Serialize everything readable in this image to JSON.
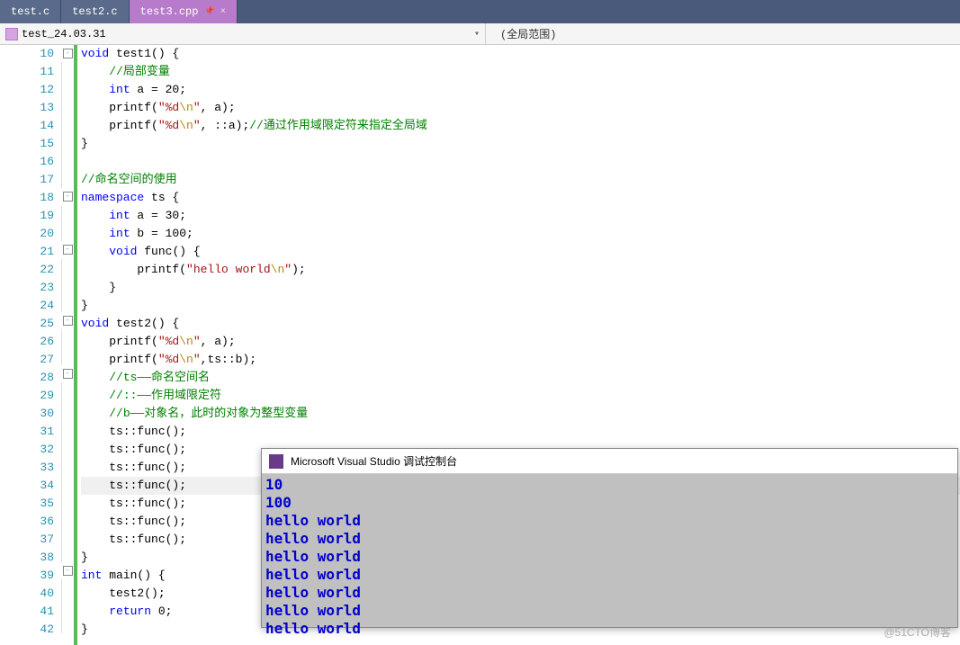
{
  "tabs": [
    {
      "label": "test.c"
    },
    {
      "label": "test2.c"
    },
    {
      "label": "test3.cpp",
      "active": true
    }
  ],
  "breadcrumb": {
    "project": "test_24.03.31",
    "scope": "(全局范围)"
  },
  "lineStart": 10,
  "lineEnd": 42,
  "code": {
    "10": [
      [
        "kw",
        "void"
      ],
      [
        "nm",
        " test1() {"
      ]
    ],
    "11": [
      [
        "nm",
        "    "
      ],
      [
        "cm",
        "//局部变量"
      ]
    ],
    "12": [
      [
        "nm",
        "    "
      ],
      [
        "kw",
        "int"
      ],
      [
        "nm",
        " a = 20;"
      ]
    ],
    "13": [
      [
        "nm",
        "    printf("
      ],
      [
        "str",
        "\"%d"
      ],
      [
        "esc",
        "\\n"
      ],
      [
        "str",
        "\""
      ],
      [
        "nm",
        ", a);"
      ]
    ],
    "14": [
      [
        "nm",
        "    printf("
      ],
      [
        "str",
        "\"%d"
      ],
      [
        "esc",
        "\\n"
      ],
      [
        "str",
        "\""
      ],
      [
        "nm",
        ", ::a);"
      ],
      [
        "cm",
        "//通过作用域限定符来指定全局域"
      ]
    ],
    "15": [
      [
        "nm",
        "}"
      ]
    ],
    "16": [
      [
        "nm",
        ""
      ]
    ],
    "17": [
      [
        "cm",
        "//命名空间的使用"
      ]
    ],
    "18": [
      [
        "kw",
        "namespace"
      ],
      [
        "nm",
        " ts {"
      ]
    ],
    "19": [
      [
        "nm",
        "    "
      ],
      [
        "kw",
        "int"
      ],
      [
        "nm",
        " a = 30;"
      ]
    ],
    "20": [
      [
        "nm",
        "    "
      ],
      [
        "kw",
        "int"
      ],
      [
        "nm",
        " b = 100;"
      ]
    ],
    "21": [
      [
        "nm",
        "    "
      ],
      [
        "kw",
        "void"
      ],
      [
        "nm",
        " func() {"
      ]
    ],
    "22": [
      [
        "nm",
        "        printf("
      ],
      [
        "str",
        "\"hello world"
      ],
      [
        "esc",
        "\\n"
      ],
      [
        "str",
        "\""
      ],
      [
        "nm",
        ");"
      ]
    ],
    "23": [
      [
        "nm",
        "    }"
      ]
    ],
    "24": [
      [
        "nm",
        "}"
      ]
    ],
    "25": [
      [
        "kw",
        "void"
      ],
      [
        "nm",
        " test2() {"
      ]
    ],
    "26": [
      [
        "nm",
        "    printf("
      ],
      [
        "str",
        "\"%d"
      ],
      [
        "esc",
        "\\n"
      ],
      [
        "str",
        "\""
      ],
      [
        "nm",
        ", a);"
      ]
    ],
    "27": [
      [
        "nm",
        "    printf("
      ],
      [
        "str",
        "\"%d"
      ],
      [
        "esc",
        "\\n"
      ],
      [
        "str",
        "\""
      ],
      [
        "nm",
        ",ts::b);"
      ]
    ],
    "28": [
      [
        "nm",
        "    "
      ],
      [
        "cm",
        "//ts——命名空间名"
      ]
    ],
    "29": [
      [
        "nm",
        "    "
      ],
      [
        "cm",
        "//::——作用域限定符"
      ]
    ],
    "30": [
      [
        "nm",
        "    "
      ],
      [
        "cm",
        "//b——对象名，此时的对象为整型变量"
      ]
    ],
    "31": [
      [
        "nm",
        "    ts::func();"
      ]
    ],
    "32": [
      [
        "nm",
        "    ts::func();"
      ]
    ],
    "33": [
      [
        "nm",
        "    ts::func();"
      ]
    ],
    "34": [
      [
        "nm",
        "    ts::func();"
      ]
    ],
    "35": [
      [
        "nm",
        "    ts::func();"
      ]
    ],
    "36": [
      [
        "nm",
        "    ts::func();"
      ]
    ],
    "37": [
      [
        "nm",
        "    ts::func();"
      ]
    ],
    "38": [
      [
        "nm",
        "}"
      ]
    ],
    "39": [
      [
        "kw",
        "int"
      ],
      [
        "nm",
        " main() {"
      ]
    ],
    "40": [
      [
        "nm",
        "    test2();"
      ]
    ],
    "41": [
      [
        "nm",
        "    "
      ],
      [
        "kw",
        "return"
      ],
      [
        "nm",
        " 0;"
      ]
    ],
    "42": [
      [
        "nm",
        "}"
      ]
    ]
  },
  "folds": {
    "10": "-",
    "18": "-",
    "21": "-",
    "25": "-",
    "28": "-",
    "39": "-"
  },
  "console": {
    "title": "Microsoft Visual Studio 调试控制台",
    "lines": [
      "10",
      "100",
      "hello world",
      "hello world",
      "hello world",
      "hello world",
      "hello world",
      "hello world",
      "hello world"
    ]
  },
  "watermark": "@51CTO博客"
}
